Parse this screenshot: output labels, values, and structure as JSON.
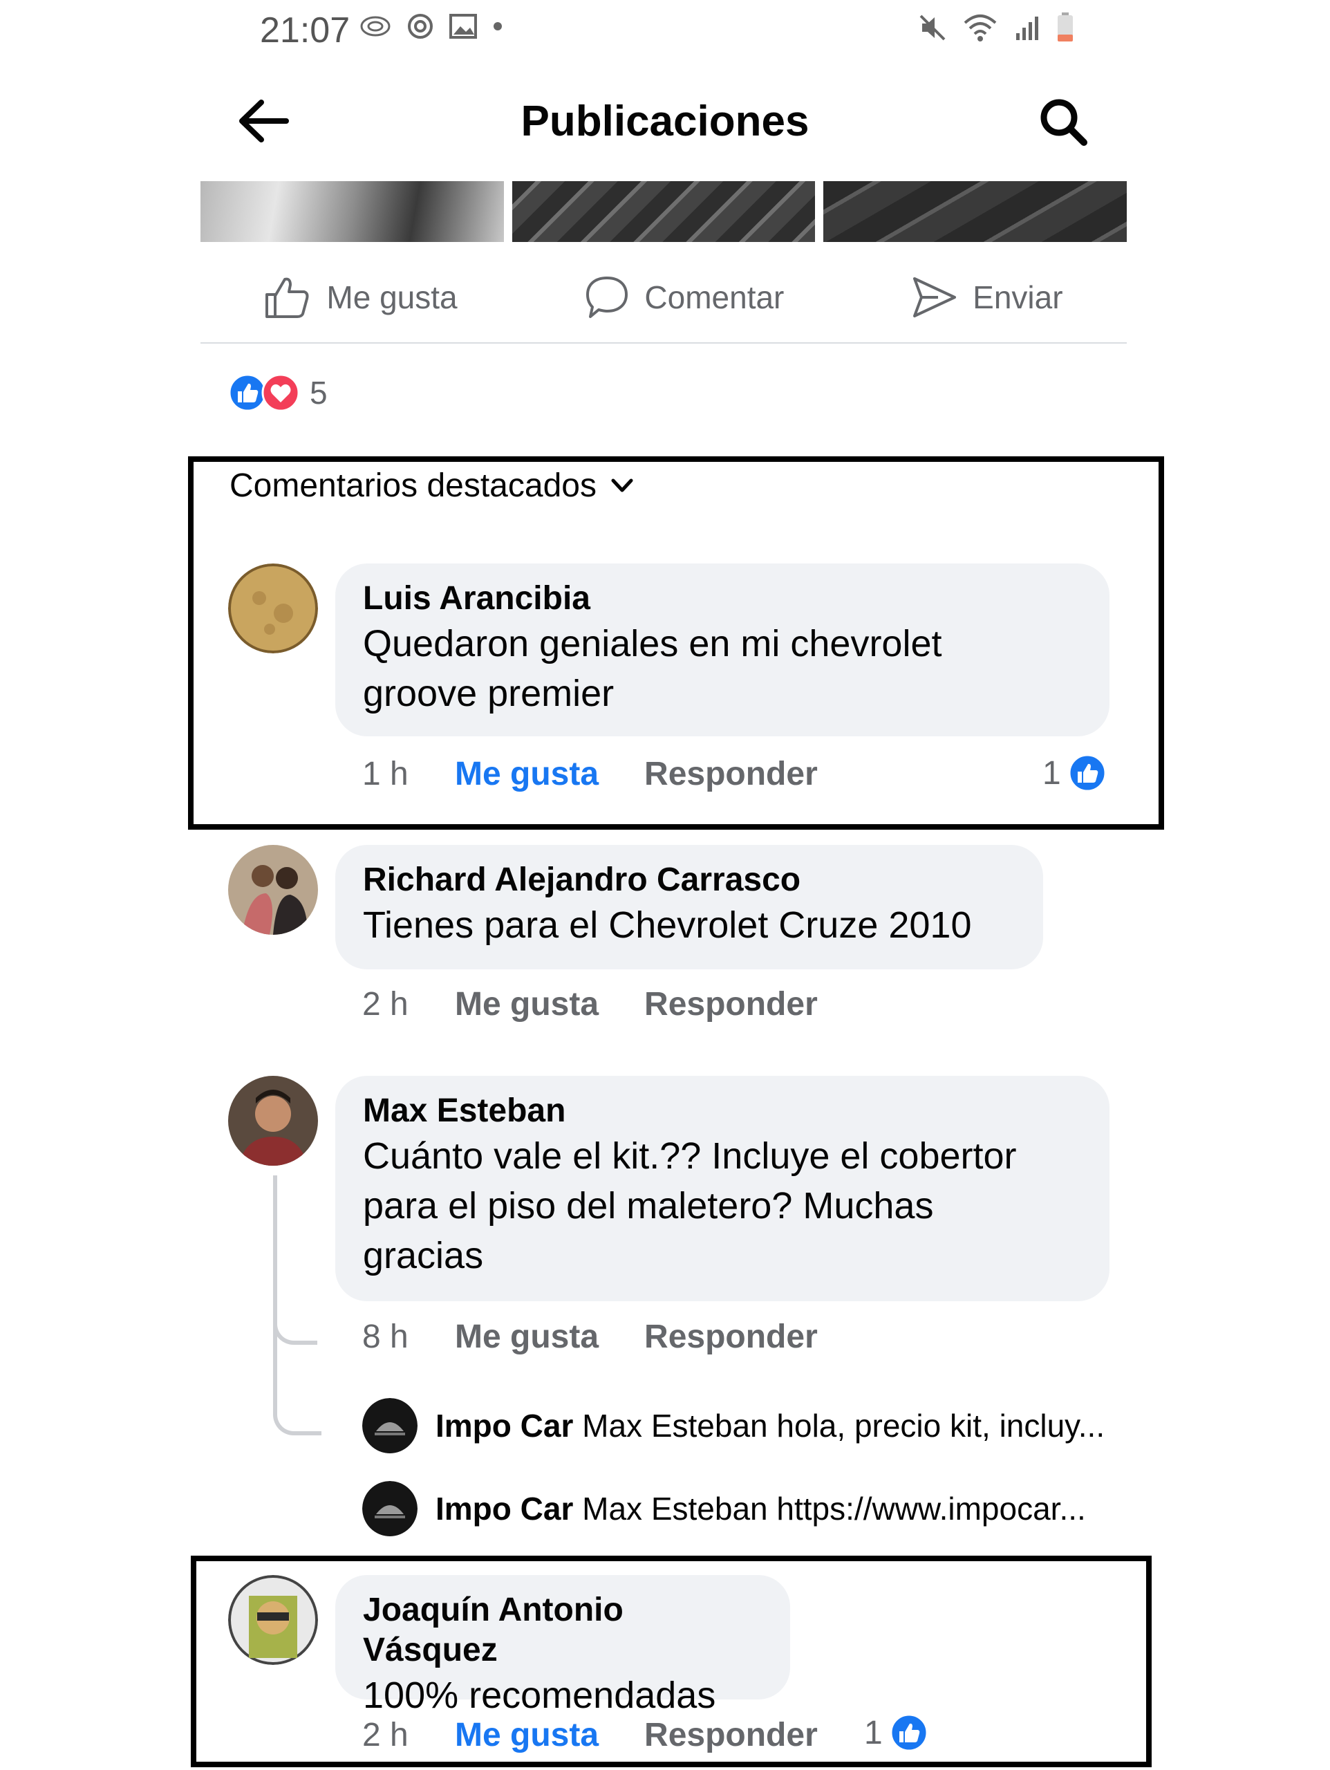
{
  "status_bar": {
    "time": "21:07"
  },
  "header": {
    "title": "Publicaciones"
  },
  "post_actions": {
    "like": "Me gusta",
    "comment": "Comentar",
    "send": "Enviar"
  },
  "reactions": {
    "count": "5"
  },
  "comments_sort": {
    "label": "Comentarios destacados"
  },
  "comments": [
    {
      "author": "Luis Arancibia",
      "lines": [
        "Quedaron geniales en mi chevrolet",
        "groove premier"
      ],
      "time": "1 h",
      "like": "Me gusta",
      "reply": "Responder",
      "like_count": "1"
    },
    {
      "author": "Richard Alejandro Carrasco",
      "lines": [
        "Tienes para el Chevrolet Cruze 2010"
      ],
      "time": "2 h",
      "like": "Me gusta",
      "reply": "Responder"
    },
    {
      "author": "Max Esteban",
      "lines": [
        "Cuánto vale el kit.?? Incluye el cobertor",
        "para el piso del maletero? Muchas",
        "gracias"
      ],
      "time": "8 h",
      "like": "Me gusta",
      "reply": "Responder",
      "replies": [
        {
          "author": "Impo Car",
          "text": "Max Esteban hola, precio kit, incluy..."
        },
        {
          "author": "Impo Car",
          "text": "Max Esteban https://www.impocar..."
        }
      ]
    },
    {
      "author": "Joaquín Antonio Vásquez",
      "lines": [
        "100% recomendadas"
      ],
      "time": "2 h",
      "like": "Me gusta",
      "reply": "Responder",
      "like_count": "1"
    }
  ],
  "colors": {
    "accent": "#1877f2",
    "bubble": "#f0f2f5",
    "secondary_text": "#65676b",
    "love": "#f33e58"
  }
}
